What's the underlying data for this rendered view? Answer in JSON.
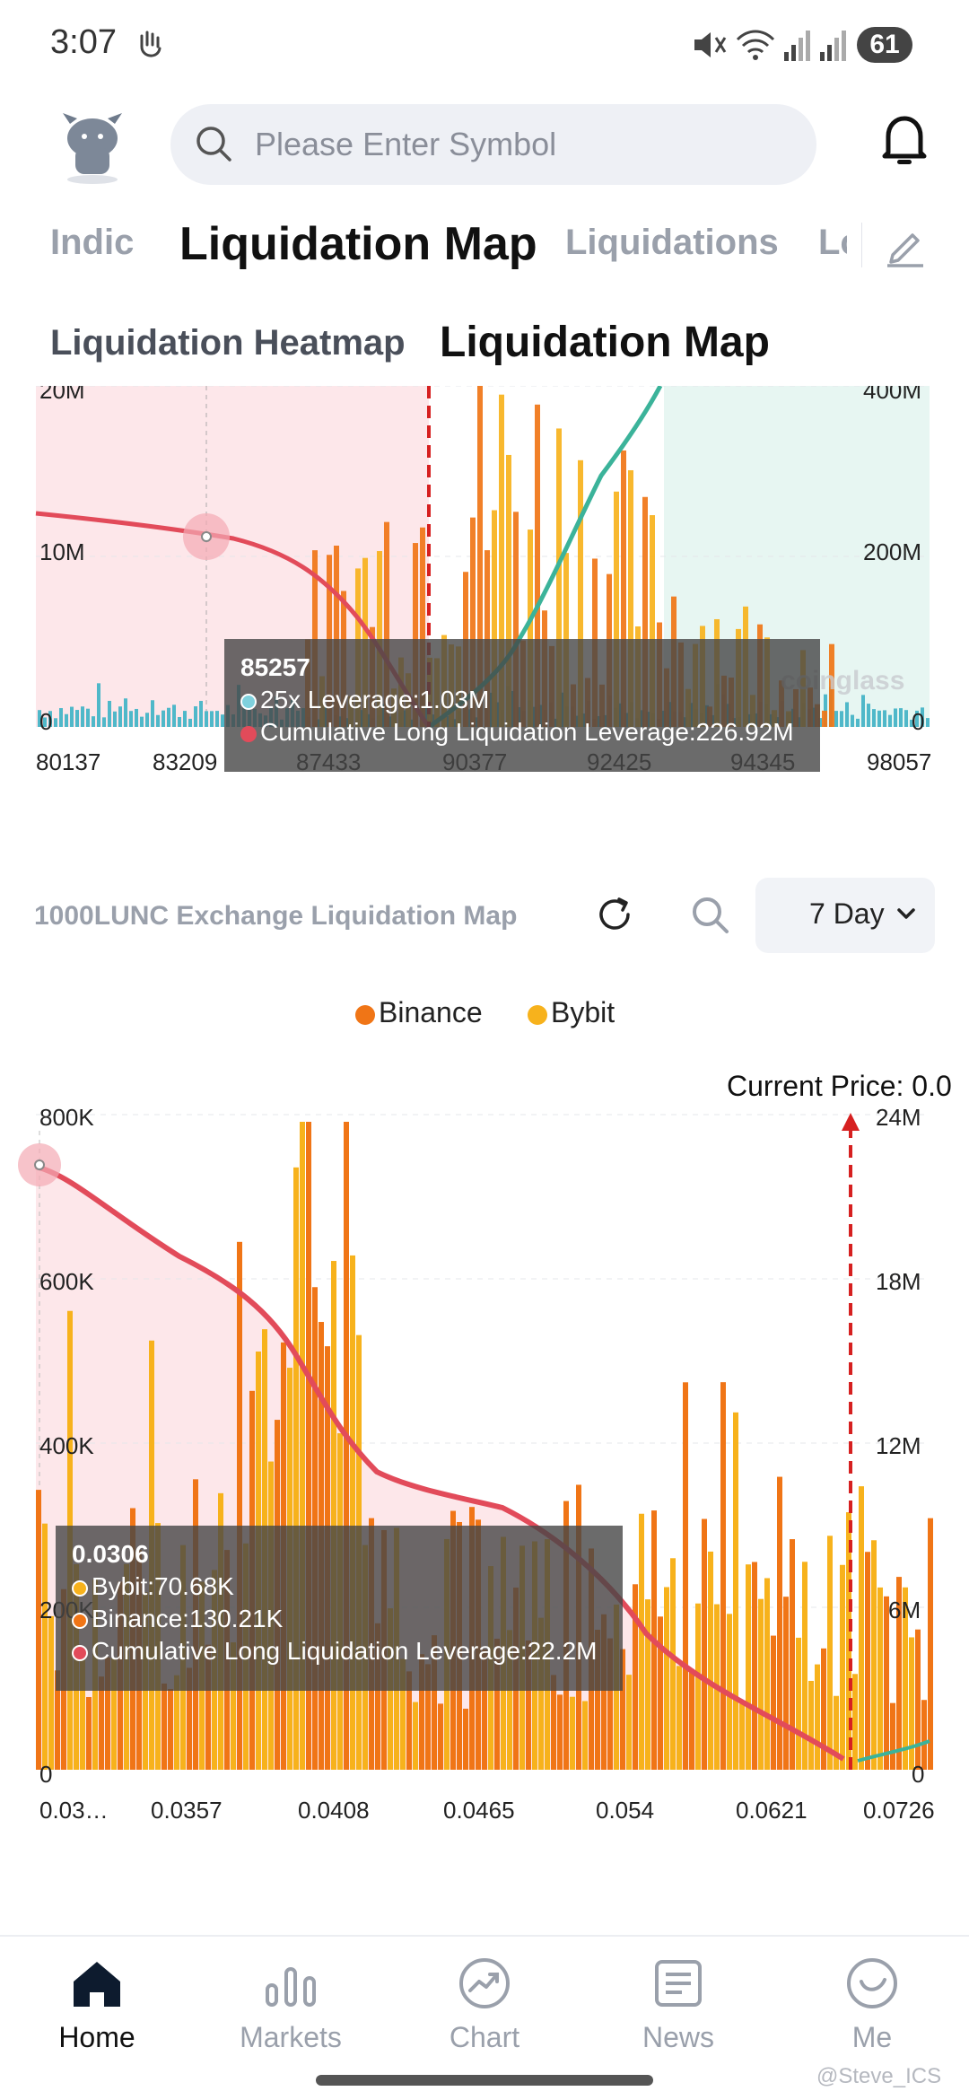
{
  "status_bar": {
    "time": "3:07",
    "battery": "61"
  },
  "header": {
    "search_placeholder": "Please Enter Symbol"
  },
  "main_tabs": [
    {
      "label": "Indic",
      "active": false
    },
    {
      "label": "Liquidation Map",
      "active": true
    },
    {
      "label": "Liquidations",
      "active": false
    },
    {
      "label": "Lo",
      "active": false
    }
  ],
  "sub_tabs": [
    {
      "label": "Liquidation Heatmap",
      "active": false
    },
    {
      "label": "Liquidation Map",
      "active": true
    }
  ],
  "chart_top": {
    "y_left_ticks": [
      "20M",
      "10M",
      "0"
    ],
    "y_right_ticks": [
      "400M",
      "200M",
      "0"
    ],
    "x_ticks": [
      "80137",
      "83209",
      "87433",
      "90377",
      "92425",
      "94345",
      "98057"
    ],
    "watermark": "coinglass",
    "tooltip": {
      "title": "85257",
      "line1": "25x Leverage:1.03M",
      "line2": "Cumulative Long Liquidation Leverage:226.92M"
    },
    "colors": {
      "long_fill": "#fde7ea",
      "short_fill": "#e7f6f2",
      "long_line": "#e24b5a",
      "short_line": "#3bb39a",
      "binance": "#f07516",
      "bybit": "#f7b21c",
      "small_bars": "#4fb8c9"
    }
  },
  "section2": {
    "title": "1000LUNC Exchange Liquidation Map",
    "period": "7 Day"
  },
  "legend": {
    "binance": "Binance",
    "bybit": "Bybit"
  },
  "chart_bottom": {
    "current_price": "Current Price: 0.0",
    "y_left_ticks": [
      "800K",
      "600K",
      "400K",
      "200K",
      "0"
    ],
    "y_right_ticks": [
      "24M",
      "18M",
      "12M",
      "6M",
      "0"
    ],
    "x_ticks": [
      "0.03…",
      "0.0357",
      "0.0408",
      "0.0465",
      "0.054",
      "0.0621",
      "0.0726"
    ],
    "tooltip": {
      "title": "0.0306",
      "bybit": "Bybit:70.68K",
      "binance": "Binance:130.21K",
      "cumulative": "Cumulative Long Liquidation Leverage:22.2M"
    }
  },
  "chart_data": [
    {
      "type": "bar",
      "x": [
        80137,
        83209,
        87433,
        90377,
        92425,
        94345,
        98057
      ],
      "ylim": [
        0,
        20000000
      ],
      "y2lim": [
        0,
        400000000
      ],
      "legend": "none",
      "grid": true,
      "series": []
    },
    {
      "type": "bar",
      "categories": [
        "0.03…",
        "0.0357",
        "0.0408",
        "0.0465",
        "0.054",
        "0.0621",
        "0.0726"
      ],
      "ylim": [
        0,
        800000
      ],
      "y2lim": [
        0,
        24000000
      ],
      "legend": "top",
      "grid": true,
      "series": [
        {
          "name": "Binance",
          "values": [
            130210,
            120000,
            380000,
            250000,
            200000,
            180000,
            90000
          ]
        },
        {
          "name": "Bybit",
          "values": [
            70680,
            90000,
            360000,
            280000,
            240000,
            150000,
            70000
          ]
        }
      ]
    }
  ],
  "bottom_nav": [
    {
      "label": "Home",
      "active": true
    },
    {
      "label": "Markets",
      "active": false
    },
    {
      "label": "Chart",
      "active": false
    },
    {
      "label": "News",
      "active": false
    },
    {
      "label": "Me",
      "active": false
    }
  ],
  "watermark_text": "@Steve_ICS"
}
